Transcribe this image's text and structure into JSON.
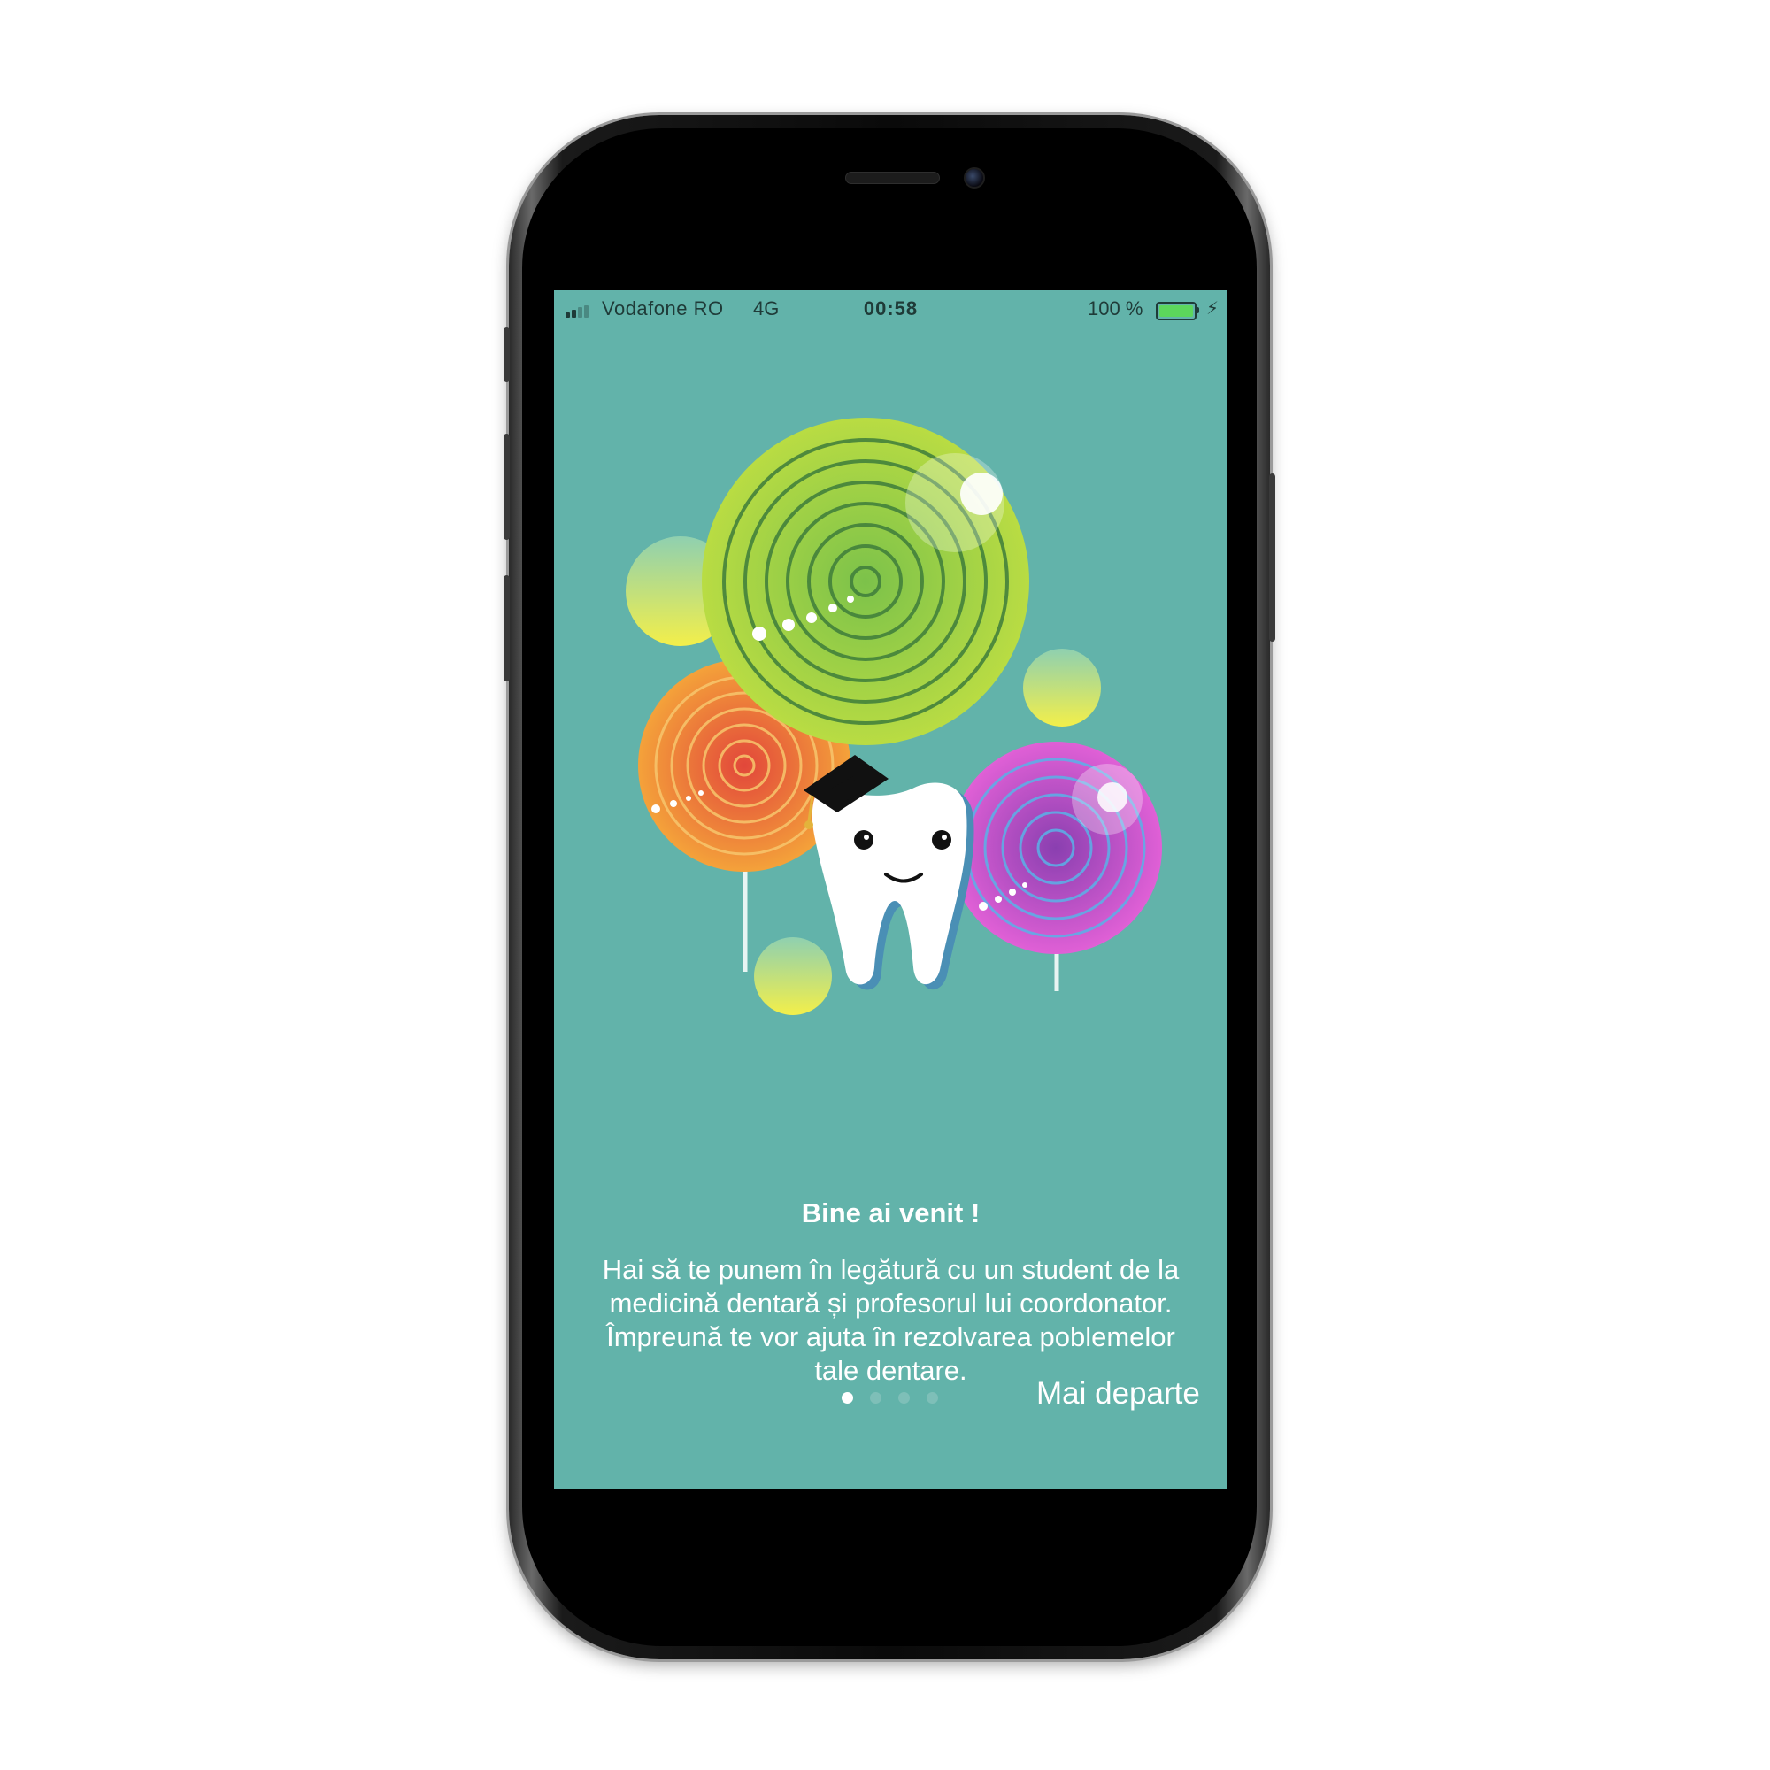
{
  "status_bar": {
    "carrier": "Vodafone RO",
    "network": "4G",
    "time": "00:58",
    "battery_percent": "100 %",
    "battery_level": 1.0,
    "signal_bars_active": 2,
    "signal_bars_total": 4,
    "charging_icon": "lightning-bolt-icon"
  },
  "onboarding": {
    "title": "Bine ai venit !",
    "description": "Hai să te punem în legătură cu un student de la\nmedicină dentară și profesorul lui coordonator.\nÎmpreună te vor ajuta în rezolvarea poblemelor\ntale dentare.",
    "illustration": "tooth-with-graduation-cap-and-lollipops",
    "next_label": "Mai departe",
    "page_count": 4,
    "active_page": 1
  },
  "colors": {
    "screen_background": "#62b3aa",
    "text": "#ffffff",
    "dot_active": "#ffffff",
    "dot_inactive": "#7ebfb8",
    "battery_fill": "#5cd65c"
  }
}
